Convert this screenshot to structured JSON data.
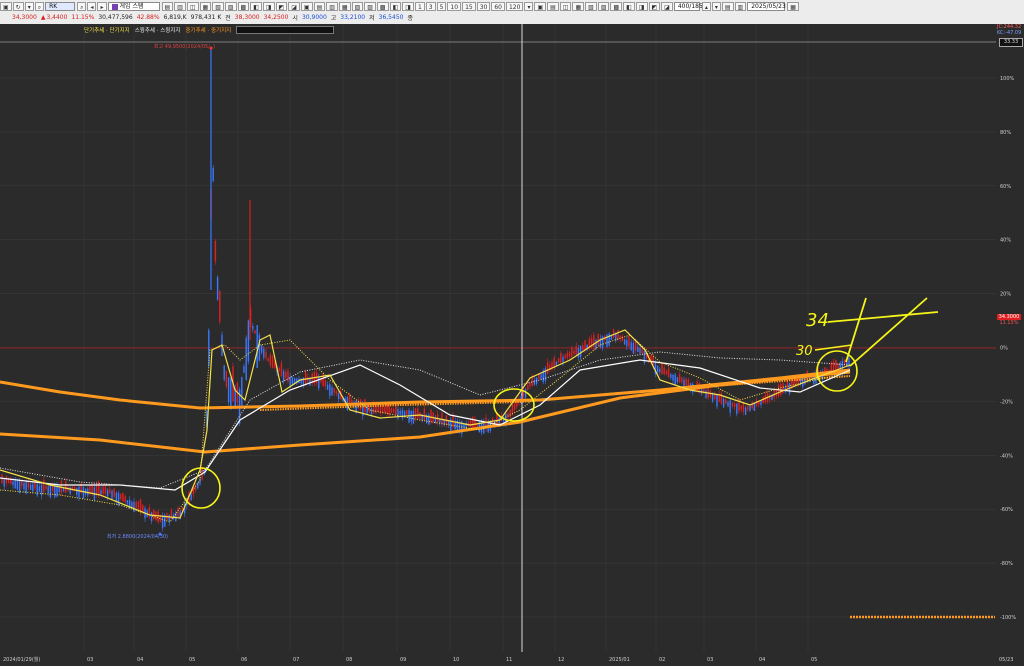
{
  "toolbar": {
    "code": "RK",
    "name": "게임 스탬",
    "period_value": "400",
    "period_total": "1859",
    "date": "2025/05/23",
    "tf_buttons": [
      "1",
      "3",
      "5",
      "10",
      "15",
      "30",
      "60",
      "120"
    ],
    "quote": {
      "price": "34,3000",
      "change_arrow": "▲",
      "change": "3,4400",
      "change_pct": "11.15%",
      "volume": "30,477,596",
      "volume_ratio": "42.88%",
      "amount": "6,819,K",
      "amount2": "978,431 K",
      "open_label": "전",
      "open": "38,3000",
      "open2": "34,2500",
      "high_label": "시",
      "high": "30,9000",
      "low_label": "고",
      "low": "33,2100",
      "close_label": "저",
      "close": "36,5450",
      "extra": "종"
    }
  },
  "legend": {
    "item1": "단기추세 · 단기지지",
    "item2": "스윙추세 · 스윙지지",
    "item3": "중기추세 · 중기지지"
  },
  "annotations": {
    "num_34": "34",
    "num_30": "30",
    "high_note": "최고 49,9500(2024/05/..)",
    "low_note": "최저 2,8800(2024/04/30)"
  },
  "right_labels": {
    "top1": "JC:244.32",
    "top2": "KC:-47.09",
    "box": "33.33",
    "price_box": "34.3000",
    "pct_box": "11.15%"
  },
  "chart_data": {
    "type": "candlestick",
    "y_axis": [
      "100%",
      "80%",
      "60%",
      "40%",
      "20%",
      "0%",
      "-20%",
      "-40%",
      "-60%",
      "-80%",
      "-100%"
    ],
    "x_axis": [
      "2024/01/29(월)",
      "03",
      "04",
      "05",
      "06",
      "07",
      "08",
      "09",
      "10",
      "11",
      "12",
      "2025/01",
      "02",
      "03",
      "04",
      "05",
      "05/23"
    ],
    "colors": {
      "up": "#e02020",
      "down": "#3a78ff",
      "short_trend": "#f5e14a",
      "swing_trend": "#ffffff",
      "mid_trend": "#ff9a1f",
      "highlight": "#f5f519"
    }
  }
}
